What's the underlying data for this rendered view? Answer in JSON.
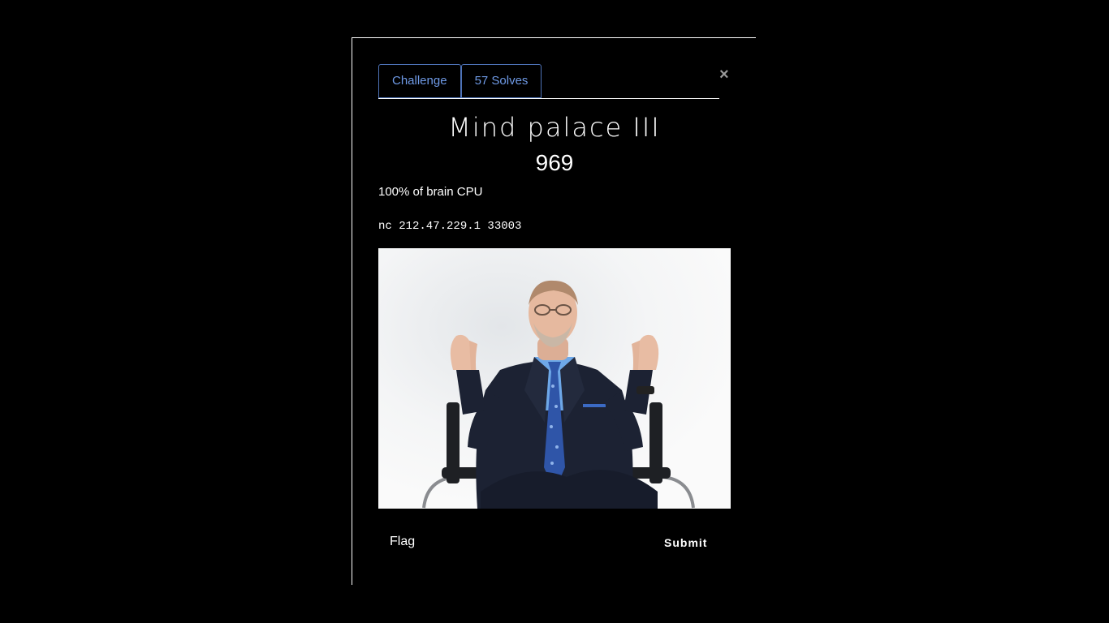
{
  "modal": {
    "tabs": [
      {
        "label": "Challenge"
      },
      {
        "label": "57 Solves"
      }
    ],
    "close_symbol": "×",
    "title": "Mind palace III",
    "points": "969",
    "description": "100% of brain CPU",
    "connection": "nc 212.47.229.1 33003",
    "image": {
      "alt": "man-in-suit-wheelchair-photo",
      "background_color": "#f4f5f6"
    },
    "flag_placeholder": "Flag",
    "submit_label": "Submit"
  },
  "colors": {
    "background": "#000000",
    "tab_border": "#4e73b8",
    "tab_text": "#6f9ae6",
    "close": "#9a9a9a"
  }
}
